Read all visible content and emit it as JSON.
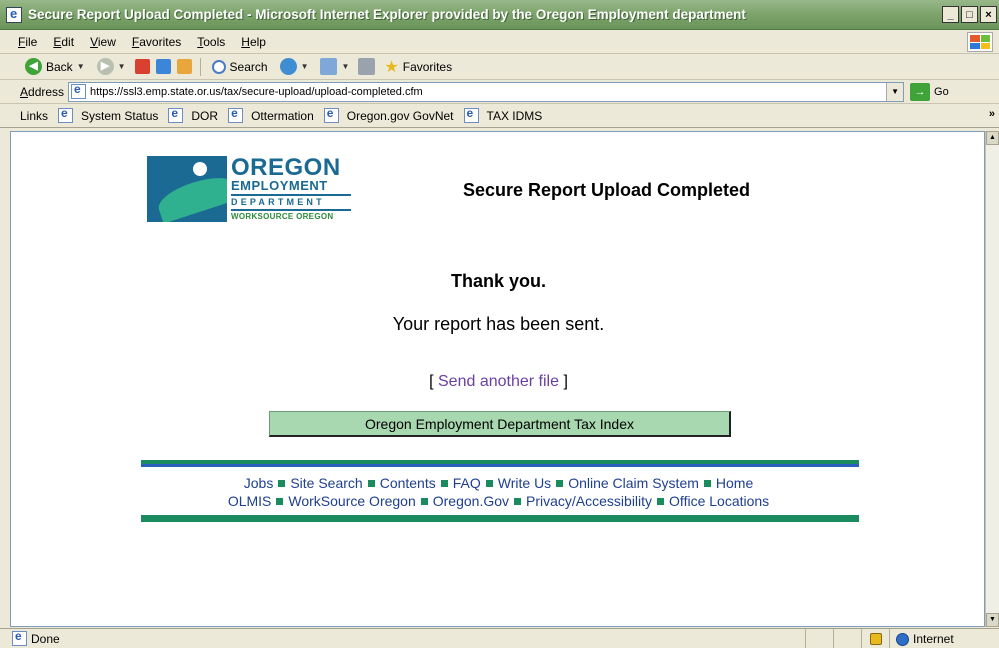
{
  "window": {
    "title": "Secure Report Upload Completed - Microsoft Internet Explorer provided by the Oregon Employment department",
    "buttons": [
      "_",
      "□",
      "×"
    ]
  },
  "menu": [
    "File",
    "Edit",
    "View",
    "Favorites",
    "Tools",
    "Help"
  ],
  "toolbar": {
    "back": "Back",
    "search": "Search",
    "favorites": "Favorites"
  },
  "address": {
    "label": "Address",
    "url": "https://ssl3.emp.state.or.us/tax/secure-upload/upload-completed.cfm",
    "go": "Go"
  },
  "links": {
    "label": "Links",
    "items": [
      "System Status",
      "DOR",
      "Ottermation",
      "Oregon.gov GovNet",
      "TAX IDMS"
    ],
    "more": "»"
  },
  "logo": {
    "line1": "OREGON",
    "line2": "EMPLOYMENT",
    "line3": "DEPARTMENT",
    "line4": "WORKSOURCE OREGON"
  },
  "content": {
    "heading": "Secure Report Upload Completed",
    "thanks": "Thank you.",
    "message": "Your report has been sent.",
    "send_another": "Send another file",
    "bracket_open": "[",
    "bracket_close": "]",
    "tax_index_button": "Oregon Employment Department Tax Index"
  },
  "footer": {
    "row1": [
      "Jobs",
      "Site Search",
      "Contents",
      "FAQ",
      "Write Us",
      "Online Claim System",
      "Home"
    ],
    "row2": [
      "OLMIS",
      "WorkSource Oregon",
      "Oregon.Gov",
      "Privacy/Accessibility",
      "Office Locations"
    ]
  },
  "status": {
    "text": "Done",
    "zone": "Internet"
  },
  "colors": {
    "titlebar": "#7fa56d",
    "brand_blue": "#1a6a93",
    "brand_green": "#1a8a5f",
    "link_visited": "#6b3fa0",
    "footer_link": "#1f3f8f",
    "button_fill": "#a8d8b0"
  }
}
